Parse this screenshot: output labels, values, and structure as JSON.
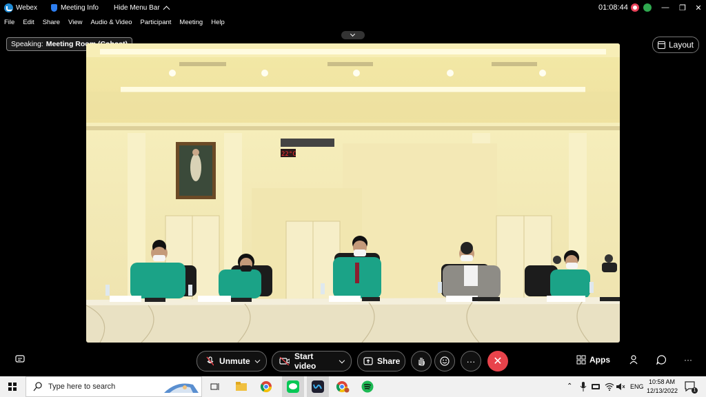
{
  "titlebar": {
    "app_name": "Webex",
    "meeting_info": "Meeting Info",
    "hide_menu": "Hide Menu Bar",
    "clock": "01:08:44",
    "minimize": "—",
    "restore": "❐",
    "close": "✕"
  },
  "menu": [
    "File",
    "Edit",
    "Share",
    "View",
    "Audio & Video",
    "Participant",
    "Meeting",
    "Help"
  ],
  "speaking": {
    "label": "Speaking:",
    "name": "Meeting Room (Cohost)"
  },
  "layout_label": "Layout",
  "video": {
    "thermostat": "22°C"
  },
  "controls": {
    "unmute": "Unmute",
    "start_video": "Start video",
    "share": "Share",
    "more": "···",
    "leave": "✕",
    "apps": "Apps",
    "more_right": "···"
  },
  "taskbar": {
    "search_placeholder": "Type here to search",
    "lang": "ENG",
    "time": "10:58 AM",
    "date": "12/13/2022",
    "notifications": "1"
  },
  "colors": {
    "leave": "#e8434b",
    "recording": "#e8435a",
    "webex": "#1e8bd6"
  }
}
